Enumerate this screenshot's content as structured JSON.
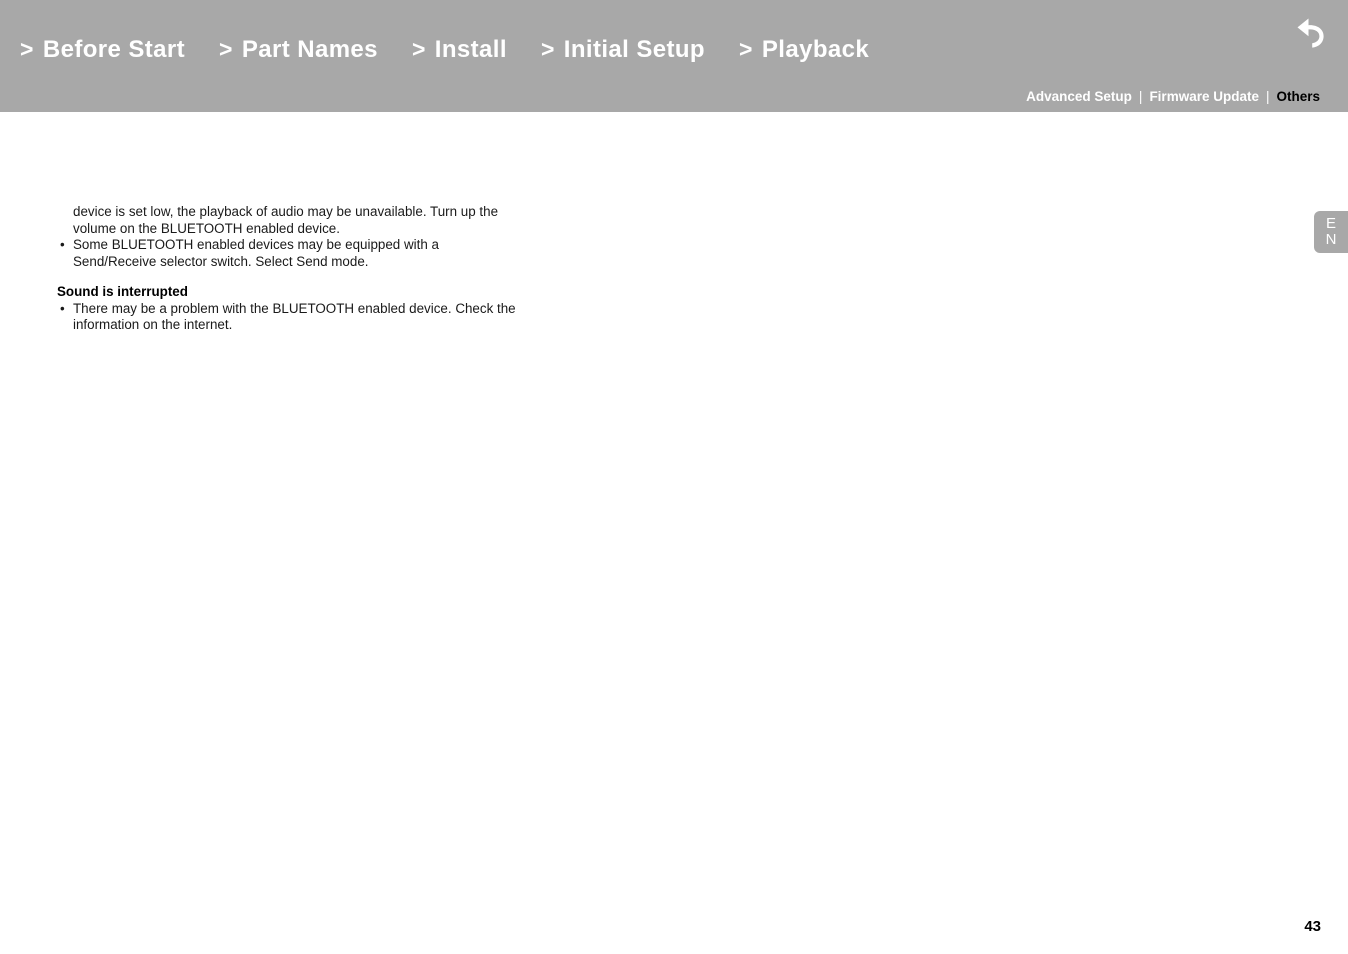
{
  "header": {
    "background_color": "#a8a8a8",
    "main_nav": [
      {
        "chevron": ">",
        "label": "Before Start"
      },
      {
        "chevron": ">",
        "label": "Part Names"
      },
      {
        "chevron": ">",
        "label": "Install"
      },
      {
        "chevron": ">",
        "label": "Initial Setup"
      },
      {
        "chevron": ">",
        "label": "Playback"
      }
    ],
    "back_arrow": "back-arrow-icon",
    "sub_nav": {
      "items": [
        {
          "label": "Advanced Setup",
          "active": false
        },
        {
          "label": "Firmware Update",
          "active": false
        },
        {
          "label": "Others",
          "active": true
        }
      ],
      "separator": "|",
      "active_color": "#000000",
      "inactive_color": "#ffffff"
    }
  },
  "language_tab": {
    "line1": "E",
    "line2": "N",
    "background_color": "#a8a8a8"
  },
  "content": {
    "continued_paragraph": "device is set low, the playback of audio may be unavailable. Turn up the volume on the BLUETOOTH enabled device.",
    "continued_bullet": "Some BLUETOOTH enabled devices may be equipped with a Send/Receive selector switch. Select Send mode.",
    "bullet_marker": "•",
    "section": {
      "heading": "Sound is interrupted",
      "bullets": [
        "There may be a problem with the BLUETOOTH enabled device. Check the information on the internet."
      ]
    }
  },
  "footer": {
    "page_number": "43"
  }
}
